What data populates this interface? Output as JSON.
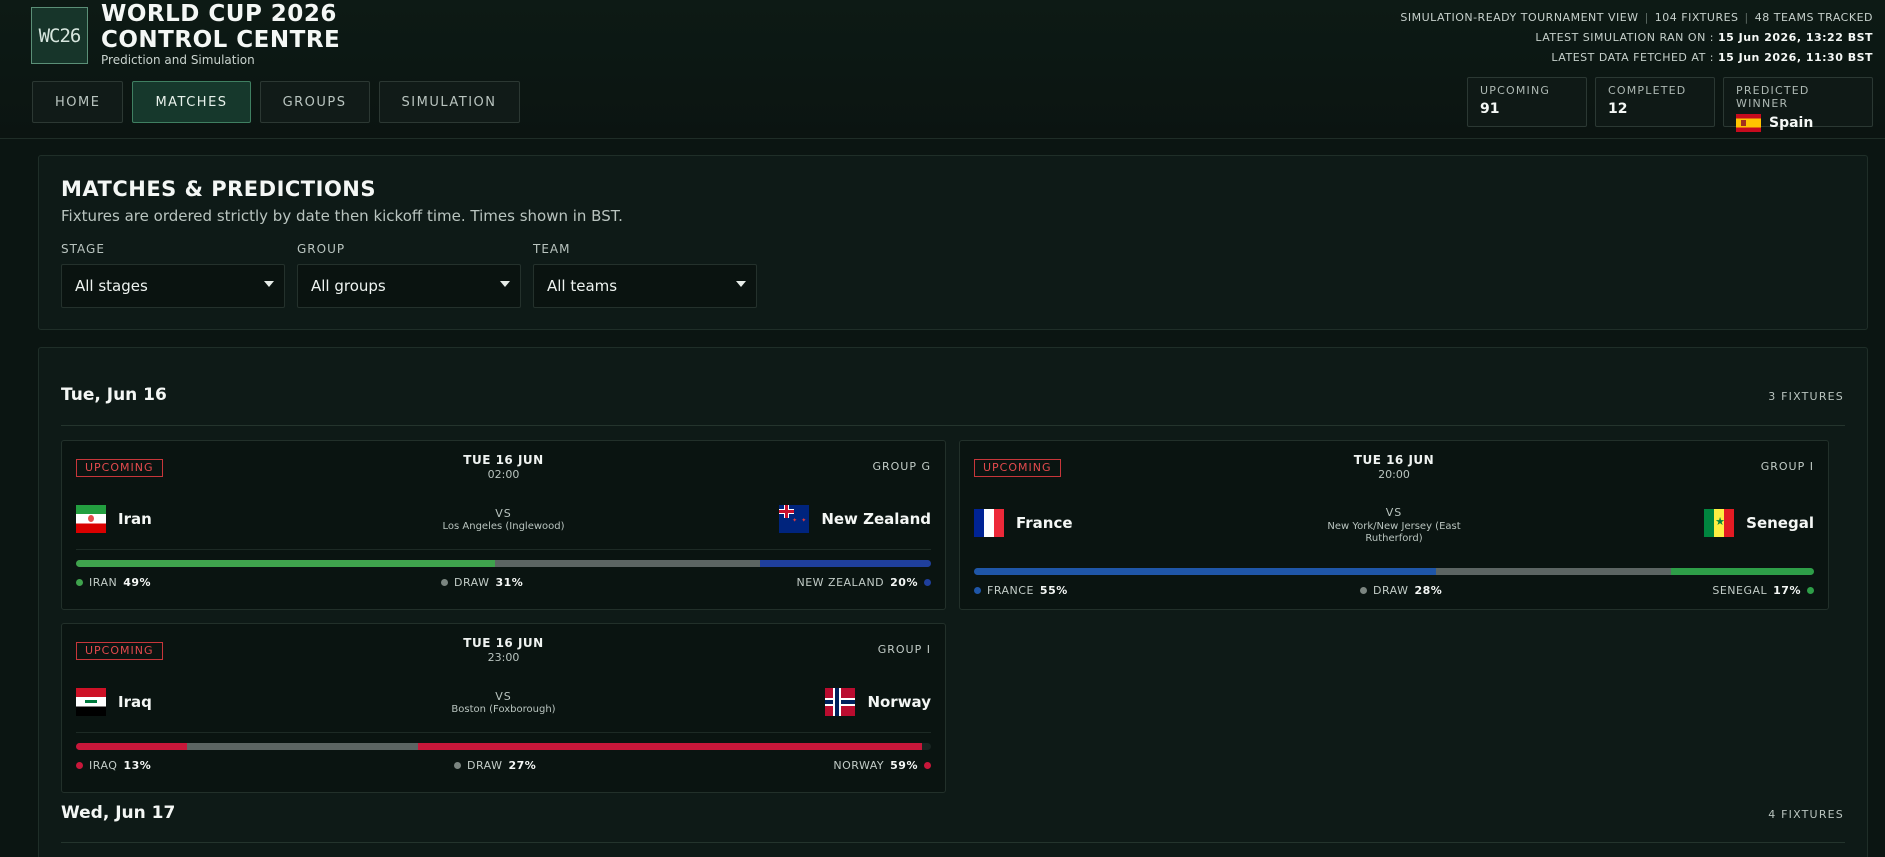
{
  "header": {
    "logo_text": "WC26",
    "title_line1": "WORLD CUP 2026",
    "title_line2": "CONTROL CENTRE",
    "subtitle": "Prediction and Simulation",
    "nav": [
      "HOME",
      "MATCHES",
      "GROUPS",
      "SIMULATION"
    ],
    "active_nav": "MATCHES",
    "meta_view": "SIMULATION-READY TOURNAMENT VIEW",
    "meta_fixtures": "104 FIXTURES",
    "meta_teams": "48 TEAMS TRACKED",
    "sim_label": "LATEST SIMULATION RAN ON :",
    "sim_value": "15 Jun 2026, 13:22 BST",
    "fetch_label": "LATEST DATA FETCHED AT :",
    "fetch_value": "15 Jun 2026, 11:30 BST",
    "stats": {
      "upcoming_label": "UPCOMING",
      "upcoming_value": "91",
      "completed_label": "COMPLETED",
      "completed_value": "12",
      "winner_label": "PREDICTED WINNER",
      "winner_value": "Spain",
      "winner_flag": "spain-flag-icon"
    }
  },
  "filters": {
    "title": "MATCHES & PREDICTIONS",
    "subtitle": "Fixtures are ordered strictly by date then kickoff time. Times shown in BST.",
    "stage_label": "STAGE",
    "stage_value": "All stages",
    "group_label": "GROUP",
    "group_value": "All groups",
    "team_label": "TEAM",
    "team_value": "All teams"
  },
  "days": [
    {
      "title": "Tue, Jun 16",
      "count": "3 FIXTURES",
      "matches": [
        {
          "status": "UPCOMING",
          "date": "TUE 16 JUN",
          "time": "02:00",
          "group": "GROUP G",
          "home": "Iran",
          "away": "New Zealand",
          "vs": "VS",
          "venue": "Los Angeles (Inglewood)",
          "home_label": "IRAN",
          "draw_label": "DRAW",
          "away_label": "NEW ZEALAND",
          "home_pct": "49%",
          "draw_pct": "31%",
          "away_pct": "20%",
          "home_color": "#3fa34d",
          "away_color": "#1f3f9c",
          "draw_color": "#5c6563",
          "home_flag": "iran-flag-icon",
          "away_flag": "new-zealand-flag-icon"
        },
        {
          "status": "UPCOMING",
          "date": "TUE 16 JUN",
          "time": "20:00",
          "group": "GROUP I",
          "home": "France",
          "away": "Senegal",
          "vs": "VS",
          "venue": "New York/New Jersey (East Rutherford)",
          "home_label": "FRANCE",
          "draw_label": "DRAW",
          "away_label": "SENEGAL",
          "home_pct": "55%",
          "draw_pct": "28%",
          "away_pct": "17%",
          "home_color": "#1f56a8",
          "away_color": "#2e9e48",
          "draw_color": "#5c6563",
          "home_flag": "france-flag-icon",
          "away_flag": "senegal-flag-icon"
        },
        {
          "status": "UPCOMING",
          "date": "TUE 16 JUN",
          "time": "23:00",
          "group": "GROUP I",
          "home": "Iraq",
          "away": "Norway",
          "vs": "VS",
          "venue": "Boston (Foxborough)",
          "home_label": "IRAQ",
          "draw_label": "DRAW",
          "away_label": "NORWAY",
          "home_pct": "13%",
          "draw_pct": "27%",
          "away_pct": "59%",
          "home_color": "#c8173a",
          "away_color": "#c8173a",
          "draw_color": "#5c6563",
          "home_flag": "iraq-flag-icon",
          "away_flag": "norway-flag-icon"
        }
      ]
    },
    {
      "title": "Wed, Jun 17",
      "count": "4 FIXTURES"
    }
  ]
}
